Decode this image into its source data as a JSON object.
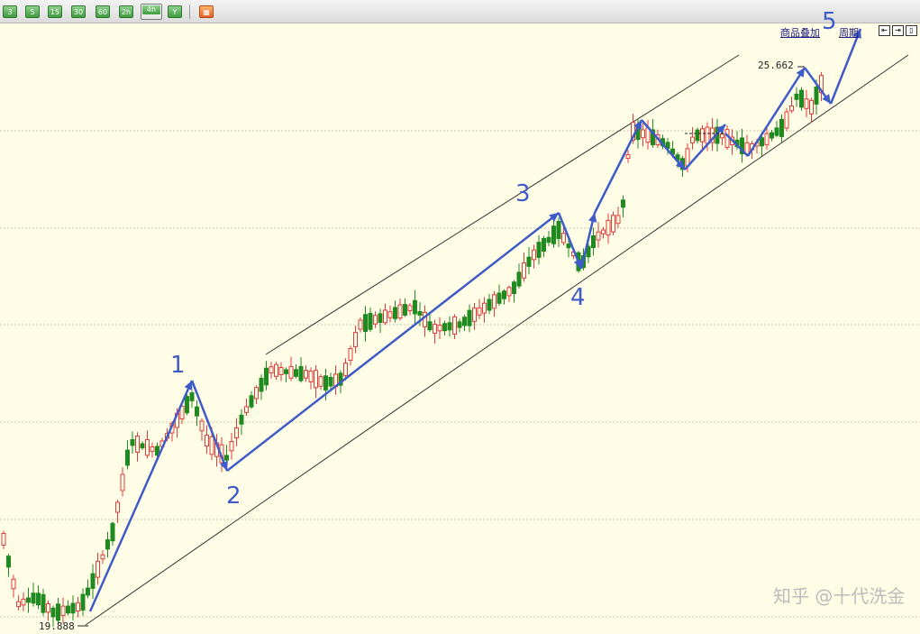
{
  "toolbar": {
    "periods": [
      "3",
      "5",
      "15",
      "30",
      "60",
      "2h",
      "4h",
      "Y"
    ],
    "active_period": "4h"
  },
  "links": {
    "overlay": "商品叠加",
    "period": "周期"
  },
  "nav_buttons": [
    "zoom-left-icon",
    "zoom-right-icon",
    "full-view-icon"
  ],
  "colors": {
    "background": "#fffde6",
    "up": "#e03c3c",
    "down": "#1f8a1f",
    "wave": "#3f5bc8",
    "channel": "#333333",
    "grid": "#c8c8b4"
  },
  "chart_data": {
    "type": "candlestick",
    "title": "",
    "price_labels": {
      "high": "25.662",
      "low": "19.888"
    },
    "waves": [
      {
        "label": "1"
      },
      {
        "label": "2"
      },
      {
        "label": "3"
      },
      {
        "label": "4"
      },
      {
        "label": "5"
      }
    ],
    "ohlc": []
  },
  "watermark": "知乎 @十代洗金"
}
